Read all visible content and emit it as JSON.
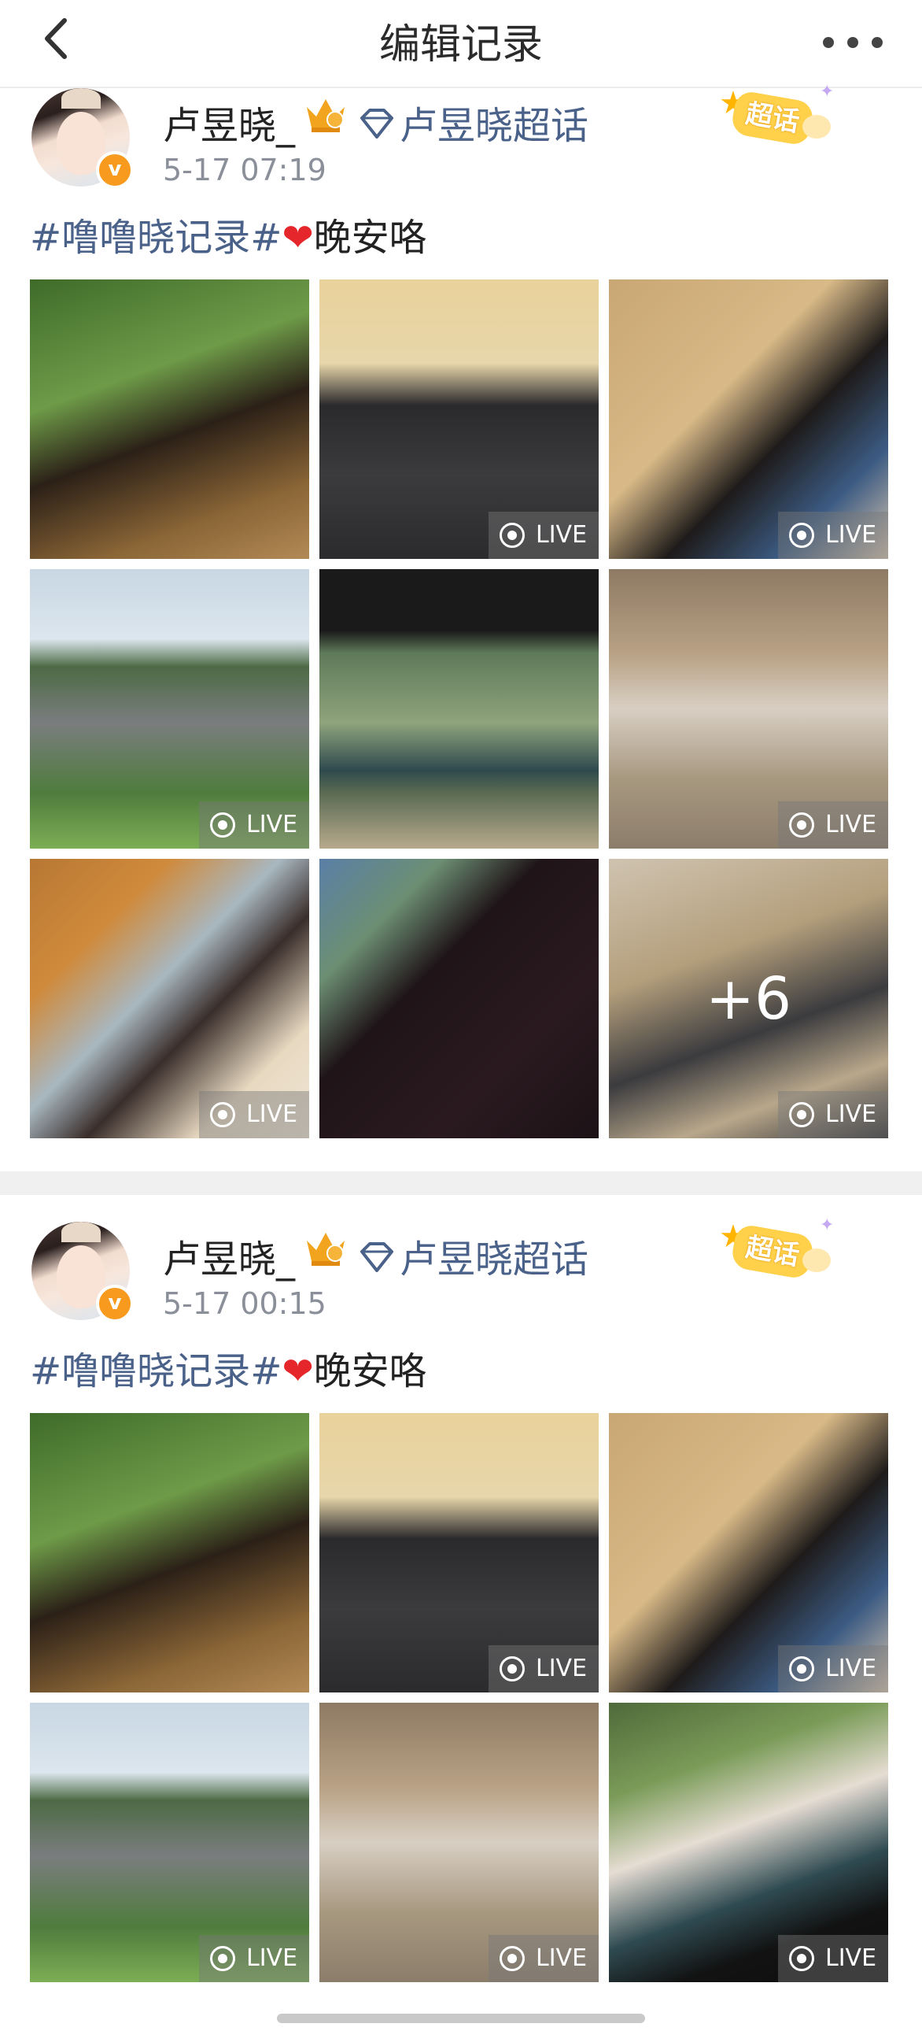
{
  "header": {
    "title": "编辑记录",
    "back_icon": "chevron-left-icon",
    "more_icon": "more-dots-icon"
  },
  "posts": [
    {
      "username": "卢昱晓_",
      "supertopic": "卢昱晓超话",
      "time": "5-17 07:19",
      "badge": "超话",
      "text": {
        "tag": "#噜噜晓记录#",
        "heart": "❤",
        "body": "晚安咯"
      },
      "images": [
        {
          "name": "garden-portrait",
          "bg": "linear-gradient(160deg,#3f6b2a 0%,#6e9b48 35%,#2b2017 55%,#8a6536 80%,#b28a56 100%)",
          "live": "",
          "more": ""
        },
        {
          "name": "stairs-crouch",
          "bg": "linear-gradient(180deg,#e9d29b 0%,#e7d6aa 30%,#2a2a2c 45%,#3b3b3e 70%,#2b2b2d 100%)",
          "live": "LIVE",
          "more": ""
        },
        {
          "name": "dog-selfie",
          "bg": "linear-gradient(135deg,#c9a774 0%,#d8b987 40%,#1e1b1a 60%,#3c5b83 80%,#d9c7b0 100%)",
          "live": "LIVE",
          "more": ""
        },
        {
          "name": "mountain-dog",
          "bg": "linear-gradient(180deg,#c8d7e3 0%,#dce6ee 25%,#4d6a45 35%,#7a7d7e 55%,#4f7c3d 80%,#7cae54 100%)",
          "live": "LIVE",
          "more": ""
        },
        {
          "name": "drama-stills",
          "bg": "linear-gradient(180deg,#1a1a1a 0%,#1a1a1a 22%,#5f7a5a 30%,#8fa37c 55%,#2f4a4e 72%,#5a6b52 80%,#b7a98d 100%)",
          "live": "",
          "more": ""
        },
        {
          "name": "stair-rails",
          "bg": "linear-gradient(180deg,#8e7a64 0%,#b8a184 30%,#d8cfc3 50%,#a79880 75%,#8c7d6b 100%)",
          "live": "LIVE",
          "more": ""
        },
        {
          "name": "dog-goggles",
          "bg": "linear-gradient(135deg,#b77834 0%,#d08a3b 25%,#a8b7c0 45%,#3a2e2b 60%,#e8d9c1 80%,#f0e6d6 100%)",
          "live": "LIVE",
          "more": ""
        },
        {
          "name": "dark-window",
          "bg": "linear-gradient(135deg,#5a7fa6 0%,#6c8f73 22%,#1f1418 40%,#2a1a20 70%,#1c1216 100%)",
          "live": "",
          "more": ""
        },
        {
          "name": "stairs-dogs",
          "bg": "linear-gradient(160deg,#cfc3b0 0%,#b49f7c 35%,#3b3b3e 60%,#b8a78b 80%,#2f2f32 100%)",
          "live": "LIVE",
          "more": "+6"
        }
      ]
    },
    {
      "username": "卢昱晓_",
      "supertopic": "卢昱晓超话",
      "time": "5-17 00:15",
      "badge": "超话",
      "text": {
        "tag": "#噜噜晓记录#",
        "heart": "❤",
        "body": "晚安咯"
      },
      "images": [
        {
          "name": "garden-portrait",
          "bg": "linear-gradient(160deg,#3f6b2a 0%,#6e9b48 35%,#2b2017 55%,#8a6536 80%,#b28a56 100%)",
          "live": "",
          "more": ""
        },
        {
          "name": "stairs-crouch",
          "bg": "linear-gradient(180deg,#e9d29b 0%,#e7d6aa 30%,#2a2a2c 45%,#3b3b3e 70%,#2b2b2d 100%)",
          "live": "LIVE",
          "more": ""
        },
        {
          "name": "dog-selfie",
          "bg": "linear-gradient(135deg,#c9a774 0%,#d8b987 40%,#1e1b1a 60%,#3c5b83 80%,#d9c7b0 100%)",
          "live": "LIVE",
          "more": ""
        },
        {
          "name": "mountain-dog",
          "bg": "linear-gradient(180deg,#c8d7e3 0%,#dce6ee 25%,#4d6a45 35%,#7a7d7e 55%,#4f7c3d 80%,#7cae54 100%)",
          "live": "LIVE",
          "more": ""
        },
        {
          "name": "stair-rails",
          "bg": "linear-gradient(180deg,#8e7a64 0%,#b8a184 30%,#d8cfc3 50%,#a79880 75%,#8c7d6b 100%)",
          "live": "LIVE",
          "more": ""
        },
        {
          "name": "elders-garden",
          "bg": "linear-gradient(160deg,#4f6a3a 0%,#7a9b58 25%,#e6ddd3 45%,#2f4b52 65%,#121212 80%,#0e0e0e 100%)",
          "live": "LIVE",
          "more": ""
        }
      ]
    }
  ]
}
